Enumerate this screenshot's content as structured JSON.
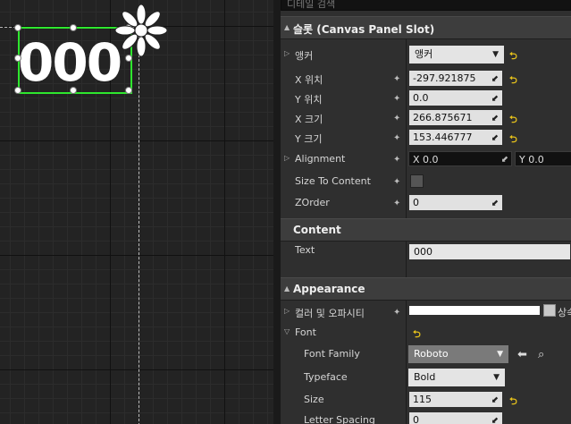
{
  "canvas": {
    "preview_text": "000"
  },
  "details": {
    "search_placeholder": "디테일 검색",
    "slot_section": {
      "title": "슬롯 (Canvas Panel Slot)",
      "anchor_label": "앵커",
      "anchor_value": "앵커",
      "x_pos_label": "X 위치",
      "x_pos_value": "-297.921875",
      "y_pos_label": "Y 위치",
      "y_pos_value": "0.0",
      "x_size_label": "X 크기",
      "x_size_value": "266.875671",
      "y_size_label": "Y 크기",
      "y_size_value": "153.446777",
      "alignment_label": "Alignment",
      "alignment_x": "X  0.0",
      "alignment_y": "Y  0.0",
      "size_to_content_label": "Size To Content",
      "zorder_label": "ZOrder",
      "zorder_value": "0"
    },
    "content_section": {
      "title": "Content",
      "text_label": "Text",
      "text_value": "000"
    },
    "appearance_section": {
      "title": "Appearance",
      "color_label": "컬러 및 오파시티",
      "color_suffix": "상속",
      "font_label": "Font",
      "font_family_label": "Font Family",
      "font_family_value": "Roboto",
      "typeface_label": "Typeface",
      "typeface_value": "Bold",
      "size_label": "Size",
      "size_value": "115",
      "letter_spacing_label": "Letter Spacing",
      "letter_spacing_value": "0"
    }
  },
  "icons": [
    "key-icon",
    "reset-arrow-icon",
    "dropdown-arrow-icon",
    "browse-arrow-icon",
    "search-icon",
    "anchor-gizmo-icon"
  ],
  "colors": {
    "selection": "#2ee62e",
    "reset": "#e7c21b",
    "panel_bg": "#2f2f2f",
    "category_bg": "#3d3d3d"
  }
}
